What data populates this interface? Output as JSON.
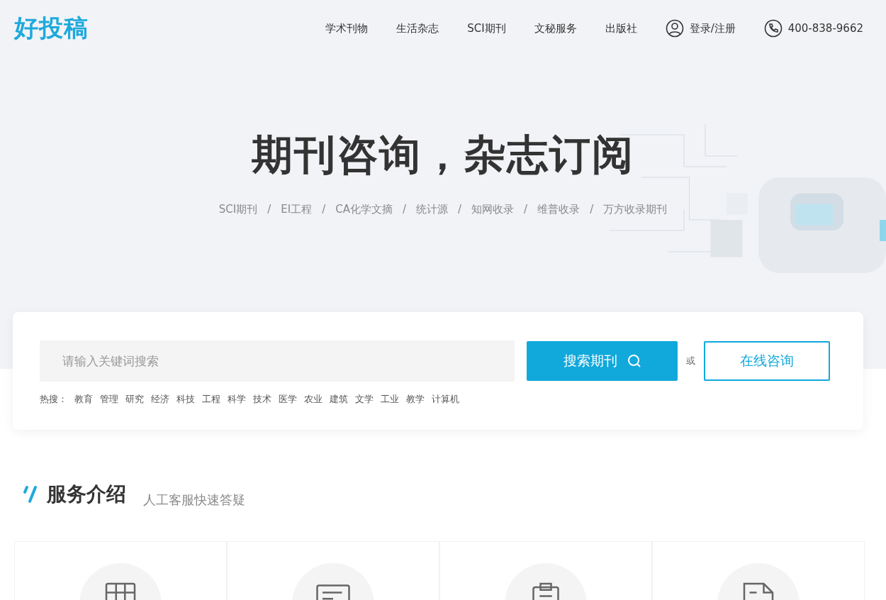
{
  "logo": "好投稿",
  "nav": [
    {
      "label": "学术刊物"
    },
    {
      "label": "生活杂志"
    },
    {
      "label": "SCI期刊"
    },
    {
      "label": "文秘服务"
    },
    {
      "label": "出版社"
    }
  ],
  "login": "登录/注册",
  "phone": "400-838-9662",
  "hero": {
    "title": "期刊咨询，杂志订阅",
    "tags": [
      {
        "label": "SCI期刊",
        "separator": "/"
      },
      {
        "label": "EI工程",
        "separator": "/"
      },
      {
        "label": "CA化学文摘",
        "separator": "/"
      },
      {
        "label": "统计源",
        "separator": "/"
      },
      {
        "label": "知网收录",
        "separator": "/"
      },
      {
        "label": "维普收录",
        "separator": "/"
      },
      {
        "label": "万方收录期刊"
      }
    ]
  },
  "search": {
    "placeholder": "请输入关键词搜索",
    "button": "搜索期刊",
    "or": "或",
    "consult": "在线咨询",
    "hot_label": "热搜：",
    "hot": [
      "教育",
      "管理",
      "研究",
      "经济",
      "科技",
      "工程",
      "科学",
      "技术",
      "医学",
      "农业",
      "建筑",
      "文学",
      "工业",
      "教学",
      "计算机"
    ]
  },
  "section": {
    "title": "服务介绍",
    "subtitle": "人工客服快速答疑"
  },
  "cards": [
    {
      "kind": "table"
    },
    {
      "kind": "form"
    },
    {
      "kind": "clipboard"
    },
    {
      "kind": "document"
    }
  ]
}
